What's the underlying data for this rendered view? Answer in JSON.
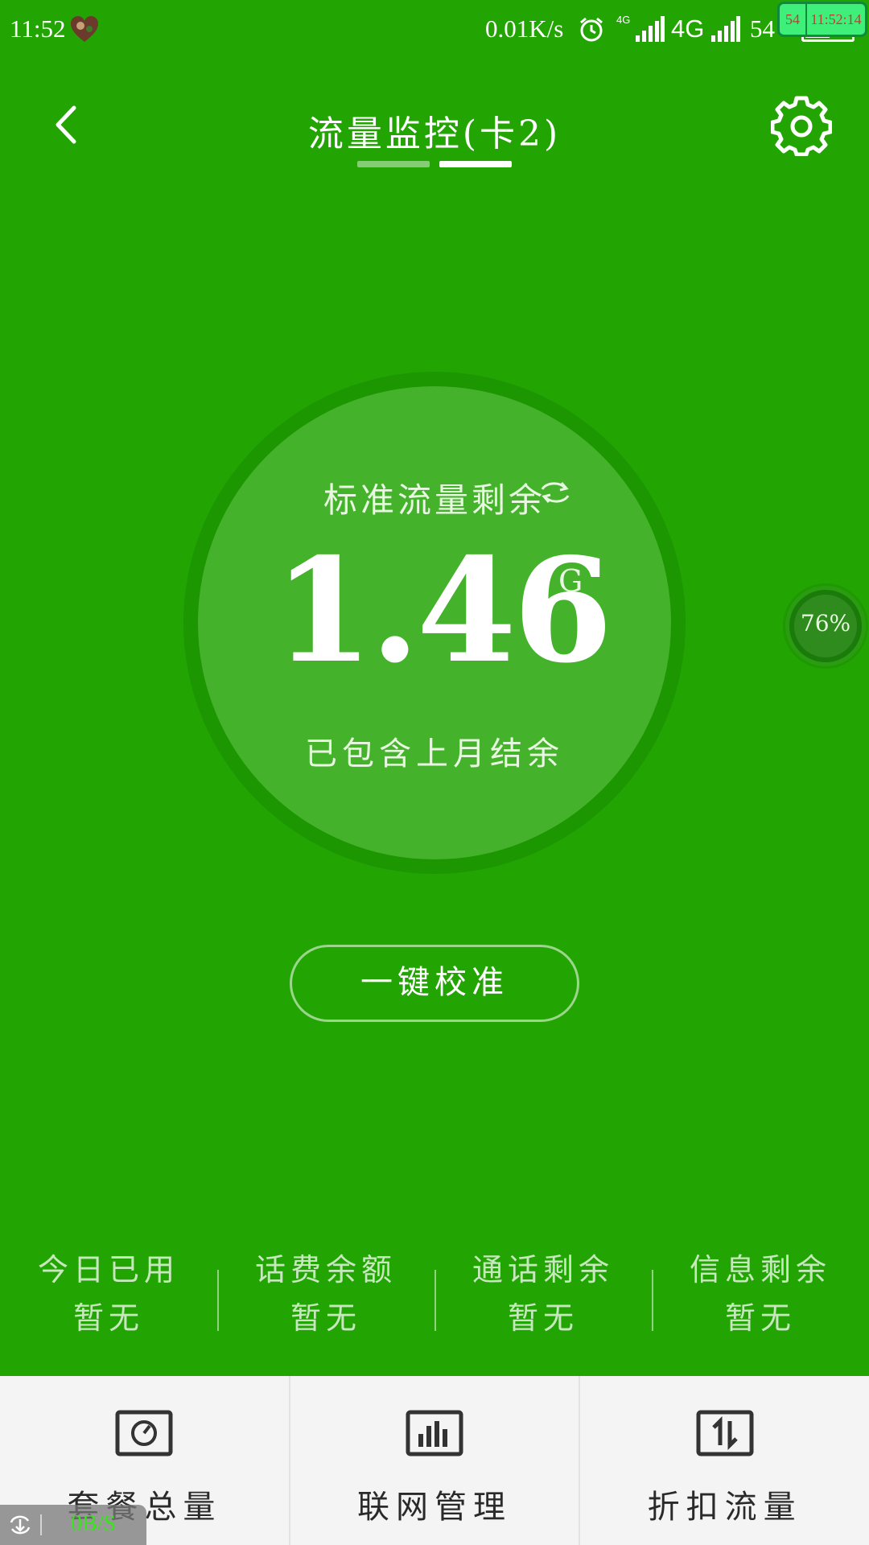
{
  "status_bar": {
    "time": "11:52",
    "net_speed": "0.01K/s",
    "network_small": "4G",
    "network": "4G",
    "battery_text": "54",
    "battery_level": 0.54,
    "overlay_left": "54",
    "overlay_time": "11:52:14"
  },
  "header": {
    "title": "流量监控(卡2)",
    "pages": 2,
    "active_page": 2
  },
  "gauge": {
    "label": "标准流量剩余",
    "value": "1.46",
    "unit": "G",
    "note": "已包含上月结余"
  },
  "float_ball": {
    "percent": "76%"
  },
  "calibrate": {
    "label": "一键校准"
  },
  "stats": [
    {
      "label": "今日已用",
      "value": "暂无"
    },
    {
      "label": "话费余额",
      "value": "暂无"
    },
    {
      "label": "通话剩余",
      "value": "暂无"
    },
    {
      "label": "信息剩余",
      "value": "暂无"
    }
  ],
  "bottom_nav": [
    {
      "label": "套餐总量",
      "icon": "gauge-icon"
    },
    {
      "label": "联网管理",
      "icon": "bar-chart-icon"
    },
    {
      "label": "折扣流量",
      "icon": "transfer-arrows-icon"
    }
  ],
  "speed_widget": {
    "value": "0B/S"
  },
  "colors": {
    "background": "#22a502",
    "gauge_ring": "#1c9601",
    "gauge_fill": "#44b22b",
    "nav_background": "#f4f4f4",
    "speed_text": "#37e61a"
  }
}
